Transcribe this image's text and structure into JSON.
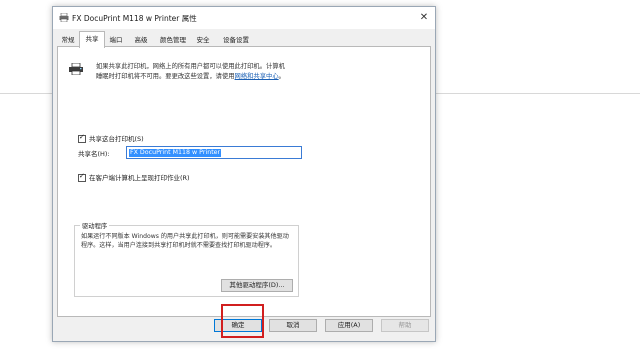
{
  "window": {
    "title": "FX DocuPrint M118 w Printer 属性",
    "close_glyph": "✕"
  },
  "tabs": [
    {
      "label": "常规"
    },
    {
      "label": "共享"
    },
    {
      "label": "端口"
    },
    {
      "label": "高级"
    },
    {
      "label": "颜色管理"
    },
    {
      "label": "安全"
    },
    {
      "label": "设备设置"
    }
  ],
  "active_tab": "共享",
  "sharing": {
    "description_line1": "如果共享此打印机，网络上的所有用户都可以使用此打印机。计算机",
    "description_line2_prefix": "睡眠时打印机将不可用。要更改这些设置，请使用",
    "description_link": "网络和共享中心",
    "description_line2_suffix": "。",
    "share_checkbox_label": "共享这台打印机(S)",
    "share_checked": true,
    "share_name_label": "共享名(H):",
    "share_name_value": "FX DocuPrint M118 w Printer",
    "render_checkbox_label": "在客户端计算机上呈现打印作业(R)",
    "render_checked": true
  },
  "drivers": {
    "legend": "驱动程序",
    "text": "如果运行不同版本 Windows 的用户共享此打印机，则可能需要安装其他驱动程序。这样，当用户连接到共享打印机时就不需要查找打印机驱动程序。",
    "button_label": "其他驱动程序(D)..."
  },
  "footer": {
    "ok_label": "确定",
    "cancel_label": "取消",
    "apply_label": "应用(A)",
    "help_label": "帮助"
  },
  "colors": {
    "highlight": "#d11f1f",
    "link": "#1a5fb4",
    "selection": "#3390ff"
  }
}
